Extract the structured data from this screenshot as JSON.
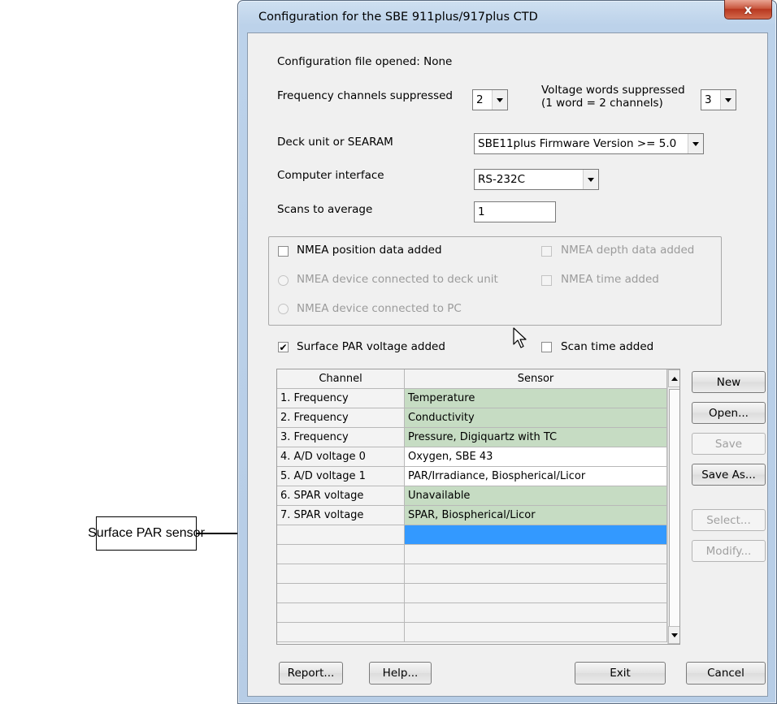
{
  "callout": {
    "label": "Surface PAR sensor"
  },
  "window": {
    "title": "Configuration for the SBE 911plus/917plus CTD",
    "close_label": "x"
  },
  "config": {
    "file_opened_label": "Configuration file opened: None",
    "freq_channels_label": "Frequency channels suppressed",
    "freq_channels_value": "2",
    "voltage_words_label": "Voltage words suppressed",
    "voltage_words_note": "(1 word = 2 channels)",
    "voltage_words_value": "3",
    "deck_unit_label": "Deck unit or SEARAM",
    "deck_unit_value": "SBE11plus Firmware Version >= 5.0",
    "computer_interface_label": "Computer interface",
    "computer_interface_value": "RS-232C",
    "scans_to_average_label": "Scans to average",
    "scans_to_average_value": "1"
  },
  "nmea": {
    "position_label": "NMEA position data added",
    "depth_label": "NMEA depth data added",
    "deck_unit_label": "NMEA device connected to deck unit",
    "time_label": "NMEA time added",
    "pc_label": "NMEA device connected to PC"
  },
  "options": {
    "surface_par_label": "Surface PAR voltage added",
    "surface_par_checked": true,
    "scan_time_label": "Scan time added",
    "scan_time_checked": false
  },
  "table": {
    "headers": [
      "Channel",
      "Sensor"
    ],
    "rows": [
      {
        "channel": "1. Frequency",
        "sensor": "Temperature",
        "status": "green"
      },
      {
        "channel": "2. Frequency",
        "sensor": "Conductivity",
        "status": "green"
      },
      {
        "channel": "3. Frequency",
        "sensor": "Pressure, Digiquartz with TC",
        "status": "green"
      },
      {
        "channel": "4. A/D voltage 0",
        "sensor": "Oxygen, SBE 43",
        "status": "white"
      },
      {
        "channel": "5. A/D voltage 1",
        "sensor": "PAR/Irradiance, Biospherical/Licor",
        "status": "white"
      },
      {
        "channel": "6. SPAR voltage",
        "sensor": "Unavailable",
        "status": "green"
      },
      {
        "channel": "7. SPAR voltage",
        "sensor": "SPAR, Biospherical/Licor",
        "status": "green"
      },
      {
        "channel": "",
        "sensor": "",
        "status": "selected"
      },
      {
        "channel": "",
        "sensor": "",
        "status": "empty"
      },
      {
        "channel": "",
        "sensor": "",
        "status": "empty"
      },
      {
        "channel": "",
        "sensor": "",
        "status": "empty"
      },
      {
        "channel": "",
        "sensor": "",
        "status": "empty"
      },
      {
        "channel": "",
        "sensor": "",
        "status": "empty"
      }
    ]
  },
  "side_buttons": {
    "new": "New",
    "open": "Open...",
    "save": "Save",
    "save_as": "Save As...",
    "select": "Select...",
    "modify": "Modify..."
  },
  "bottom_buttons": {
    "report": "Report...",
    "help": "Help...",
    "exit": "Exit",
    "cancel": "Cancel"
  },
  "colors": {
    "assigned_sensor": "#c6dcc3",
    "selected_row": "#3399ff",
    "close_button": "#c9573e"
  }
}
